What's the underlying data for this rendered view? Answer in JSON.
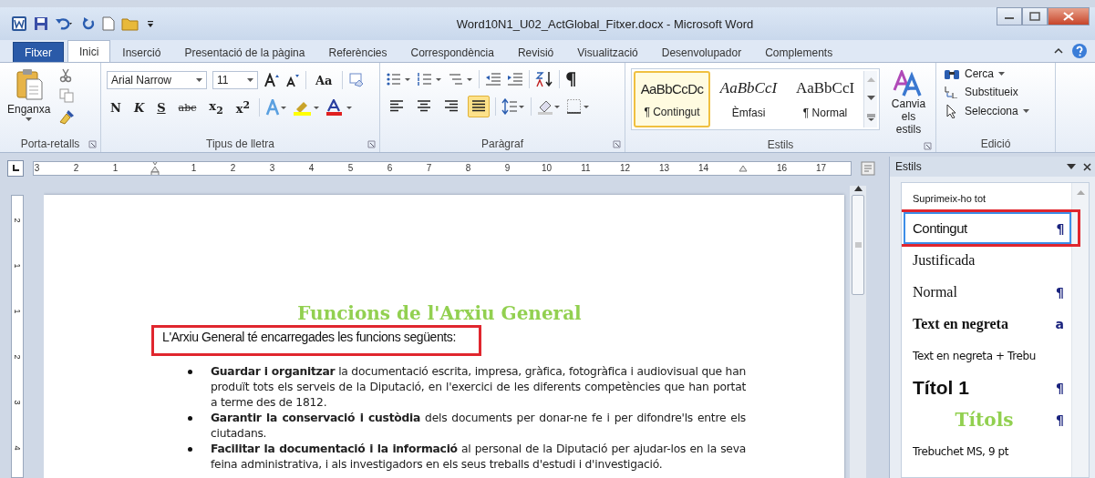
{
  "window": {
    "title": "Word10N1_U02_ActGlobal_Fitxer.docx - Microsoft Word"
  },
  "tabs": [
    {
      "label": "Fitxer",
      "kind": "file",
      "selected": false
    },
    {
      "label": "Inici",
      "kind": "tab",
      "selected": true
    },
    {
      "label": "Inserció",
      "kind": "tab",
      "selected": false
    },
    {
      "label": "Presentació de la pàgina",
      "kind": "tab",
      "selected": false
    },
    {
      "label": "Referències",
      "kind": "tab",
      "selected": false
    },
    {
      "label": "Correspondència",
      "kind": "tab",
      "selected": false
    },
    {
      "label": "Revisió",
      "kind": "tab",
      "selected": false
    },
    {
      "label": "Visualització",
      "kind": "tab",
      "selected": false
    },
    {
      "label": "Desenvolupador",
      "kind": "tab",
      "selected": false
    },
    {
      "label": "Complements",
      "kind": "tab",
      "selected": false
    }
  ],
  "ribbon": {
    "clipboard": {
      "paste_label": "Enganxa",
      "group_label": "Porta-retalls"
    },
    "font": {
      "font_name": "Arial Narrow",
      "font_size": "11",
      "change_case": "Aa",
      "format_buttons": [
        {
          "label": "N",
          "kind": "bold"
        },
        {
          "label": "K",
          "kind": "italic"
        },
        {
          "label": "S",
          "kind": "underline"
        },
        {
          "label": "abc",
          "kind": "strike"
        },
        {
          "label": "x$_{2}$",
          "kind": "plain"
        },
        {
          "label": "x$^{2}$",
          "kind": "plain"
        }
      ],
      "group_label": "Tipus de lletra"
    },
    "paragraph": {
      "alignments": [
        {
          "kind": "left",
          "selected": false
        },
        {
          "kind": "center",
          "selected": false
        },
        {
          "kind": "right",
          "selected": false
        },
        {
          "kind": "justify",
          "selected": true
        }
      ],
      "group_label": "Paràgraf"
    },
    "styles": {
      "gallery": [
        {
          "preview": "AaBbCcDc",
          "name": "¶ Contingut",
          "kind": "sans",
          "selected": true
        },
        {
          "preview": "AaBbCcI",
          "name": "Èmfasi",
          "kind": "italic",
          "selected": false
        },
        {
          "preview": "AaBbCcI",
          "name": "¶ Normal",
          "kind": "serif",
          "selected": false
        }
      ],
      "change_styles": "Canvia els estils",
      "group_label": "Estils"
    },
    "editing": {
      "items": [
        {
          "label": "Cerca",
          "kind": "find"
        },
        {
          "label": "Substitueix",
          "kind": "replace"
        },
        {
          "label": "Selecciona",
          "kind": "select"
        }
      ],
      "group_label": "Edició"
    }
  },
  "ruler": [
    {
      "kind": "number",
      "label": "3"
    },
    {
      "kind": "number",
      "label": "2"
    },
    {
      "kind": "number",
      "label": "1"
    },
    {
      "kind": "indent"
    },
    {
      "kind": "number",
      "label": "1"
    },
    {
      "kind": "number",
      "label": "2"
    },
    {
      "kind": "number",
      "label": "3"
    },
    {
      "kind": "number",
      "label": "4"
    },
    {
      "kind": "number",
      "label": "5"
    },
    {
      "kind": "number",
      "label": "6"
    },
    {
      "kind": "number",
      "label": "7"
    },
    {
      "kind": "number",
      "label": "8"
    },
    {
      "kind": "number",
      "label": "9"
    },
    {
      "kind": "number",
      "label": "10"
    },
    {
      "kind": "number",
      "label": "11"
    },
    {
      "kind": "number",
      "label": "12"
    },
    {
      "kind": "number",
      "label": "13"
    },
    {
      "kind": "number",
      "label": "14"
    },
    {
      "kind": "right-indent"
    },
    {
      "kind": "number",
      "label": "16"
    },
    {
      "kind": "number",
      "label": "17"
    }
  ],
  "vertical_ruler": [
    "2",
    "1",
    "1",
    "2",
    "3",
    "4"
  ],
  "document": {
    "heading": "Funcions de l'Arxiu General",
    "intro": "L'Arxiu General té encarregades les funcions següents:",
    "bullets": [
      "**Guardar i organitzar** la documentació escrita, impresa, gràfica, fotogràfica i audiovisual que han produït tots els serveis de la Diputació, en l'exercici de les diferents competències que han portat a terme des de 1812.",
      "**Garantir la conservació i custòdia** dels documents per donar-ne fe i per difondre'ls entre els ciutadans.",
      "**Facilitar la documentació i la informació** al personal de la Diputació per ajudar-los en la seva feina administrativa, i als investigadors en els seus treballs d'estudi i d'investigació."
    ]
  },
  "styles_pane": {
    "title": "Estils",
    "items": [
      {
        "label": "Suprimeix-ho tot",
        "kind": "clear",
        "selected": false
      },
      {
        "label": "Contingut",
        "kind": "sans",
        "marker": "¶",
        "selected": true
      },
      {
        "label": "Justificada",
        "kind": "serif",
        "selected": false
      },
      {
        "label": "Normal",
        "kind": "serif",
        "marker": "¶",
        "selected": false
      },
      {
        "label": "Text en negreta",
        "kind": "bold-serif",
        "marker": "a",
        "selected": false
      },
      {
        "label": "Text en negreta + Trebu",
        "kind": "trebuchet",
        "selected": false
      },
      {
        "label": "Títol 1",
        "kind": "heading",
        "marker": "¶",
        "selected": false
      },
      {
        "label": "Títols",
        "kind": "green",
        "marker": "¶",
        "selected": false
      },
      {
        "label": "Trebuchet MS, 9 pt",
        "kind": "trebuchet",
        "selected": false
      }
    ]
  }
}
